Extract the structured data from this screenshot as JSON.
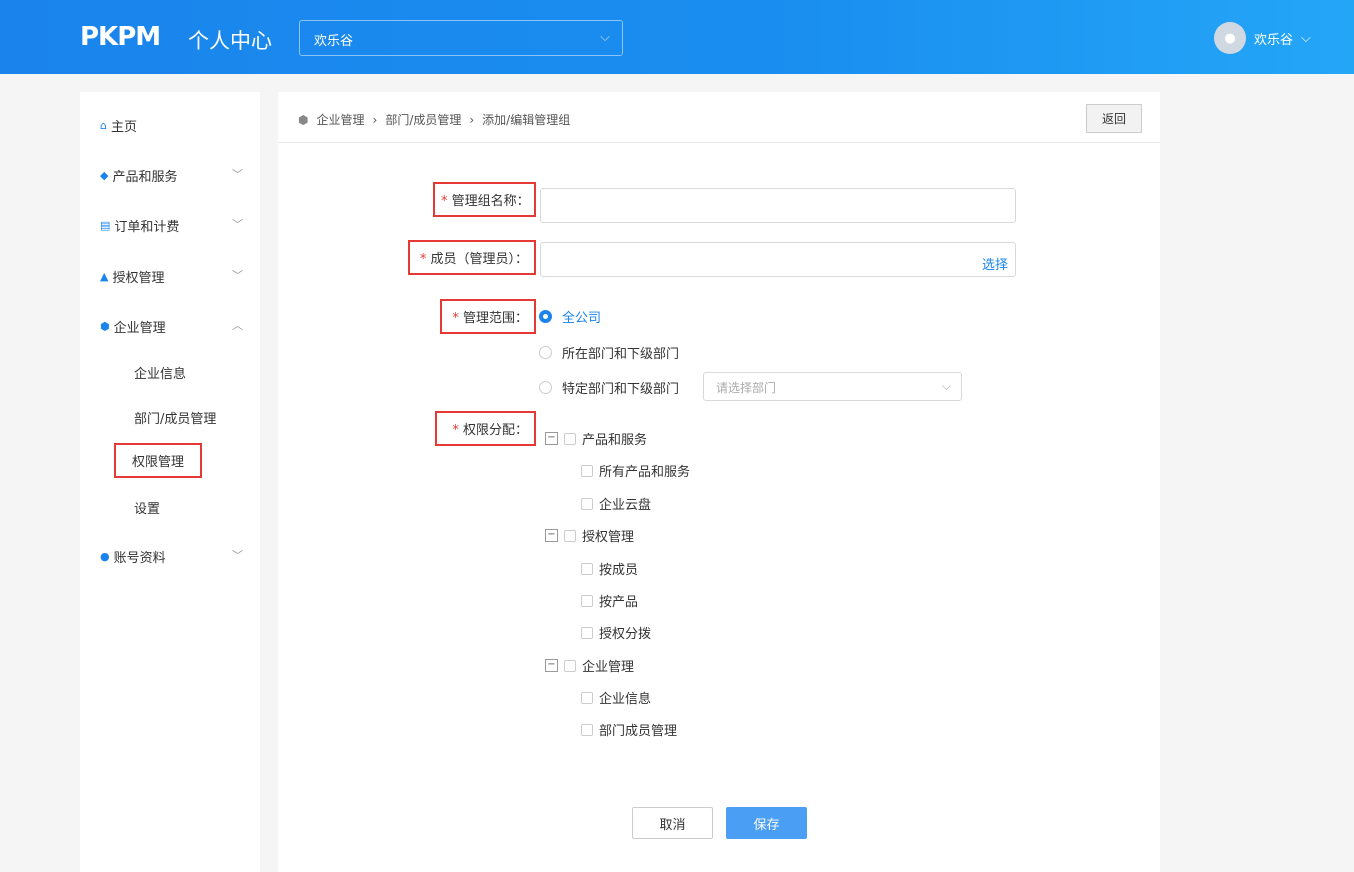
{
  "header": {
    "logo": "PKPM",
    "title": "个人中心",
    "org": "欢乐谷",
    "user": "欢乐谷"
  },
  "sidebar": {
    "items": [
      {
        "label": "主页"
      },
      {
        "label": "产品和服务"
      },
      {
        "label": "订单和计费"
      },
      {
        "label": "授权管理"
      },
      {
        "label": "企业管理"
      },
      {
        "label": "账号资料"
      }
    ],
    "sub": [
      {
        "label": "企业信息"
      },
      {
        "label": "部门/成员管理"
      },
      {
        "label": "权限管理"
      },
      {
        "label": "设置"
      }
    ]
  },
  "breadcrumb": [
    "企业管理",
    "部门/成员管理",
    "添加/编辑管理组"
  ],
  "back": "返回",
  "form": {
    "name_label": "管理组名称：",
    "name_value": "",
    "member_label": "成员（管理员）：",
    "member_pick": "选择",
    "scope_label": "管理范围：",
    "scope_options": [
      "全公司",
      "所在部门和下级部门",
      "特定部门和下级部门"
    ],
    "dept_placeholder": "请选择部门",
    "perm_label": "权限分配：",
    "tree": [
      {
        "label": "产品和服务",
        "children": [
          "所有产品和服务",
          "企业云盘"
        ]
      },
      {
        "label": "授权管理",
        "children": [
          "按成员",
          "按产品",
          "授权分拨"
        ]
      },
      {
        "label": "企业管理",
        "children": [
          "企业信息",
          "部门成员管理"
        ]
      }
    ]
  },
  "buttons": {
    "cancel": "取消",
    "save": "保存"
  },
  "colors": {
    "primary": "#1a84ec",
    "highlight": "#e53935"
  }
}
